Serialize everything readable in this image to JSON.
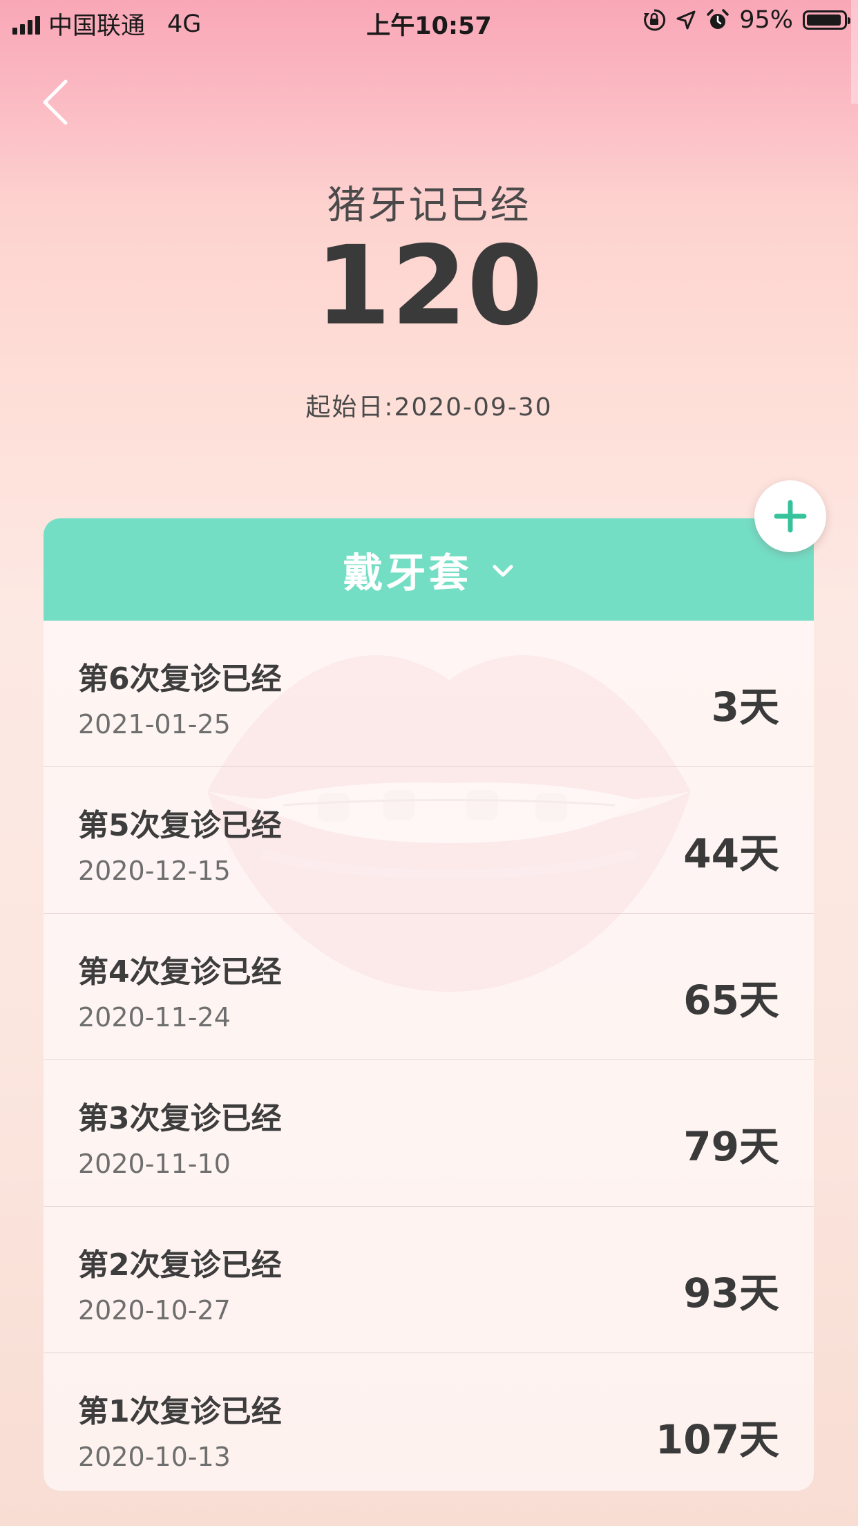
{
  "status_bar": {
    "carrier": "中国联通",
    "network": "4G",
    "time": "上午10:57",
    "battery_percent": "95%",
    "battery_level": 0.95
  },
  "header": {
    "title": "猪牙记已经",
    "count": "120",
    "start_date": "起始日:2020-09-30"
  },
  "card": {
    "category_label": "戴牙套",
    "rows": [
      {
        "title": "第6次复诊已经",
        "date": "2021-01-25",
        "days": "3天"
      },
      {
        "title": "第5次复诊已经",
        "date": "2020-12-15",
        "days": "44天"
      },
      {
        "title": "第4次复诊已经",
        "date": "2020-11-24",
        "days": "65天"
      },
      {
        "title": "第3次复诊已经",
        "date": "2020-11-10",
        "days": "79天"
      },
      {
        "title": "第2次复诊已经",
        "date": "2020-10-27",
        "days": "93天"
      },
      {
        "title": "第1次复诊已经",
        "date": "2020-10-13",
        "days": "107天"
      }
    ]
  },
  "colors": {
    "accent_green": "#74dec5",
    "add_plus": "#36c39b",
    "background_top": "#f9a7b7",
    "background_bottom": "#f8ddd3"
  },
  "icons": {
    "back": "chevron-left-icon",
    "add": "plus-icon",
    "dropdown": "chevron-down-icon"
  }
}
